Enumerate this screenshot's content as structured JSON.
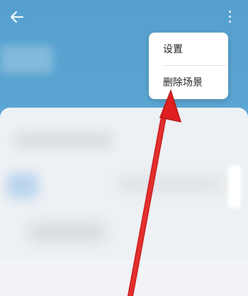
{
  "menu": {
    "items": [
      {
        "label": "设置"
      },
      {
        "label": "删除场景"
      }
    ]
  },
  "icons": {
    "back": "arrow-left-icon",
    "more": "more-vertical-icon"
  },
  "colors": {
    "header_background": "#55a0cf",
    "menu_background": "#ffffff",
    "annotation_arrow": "#e02020"
  }
}
